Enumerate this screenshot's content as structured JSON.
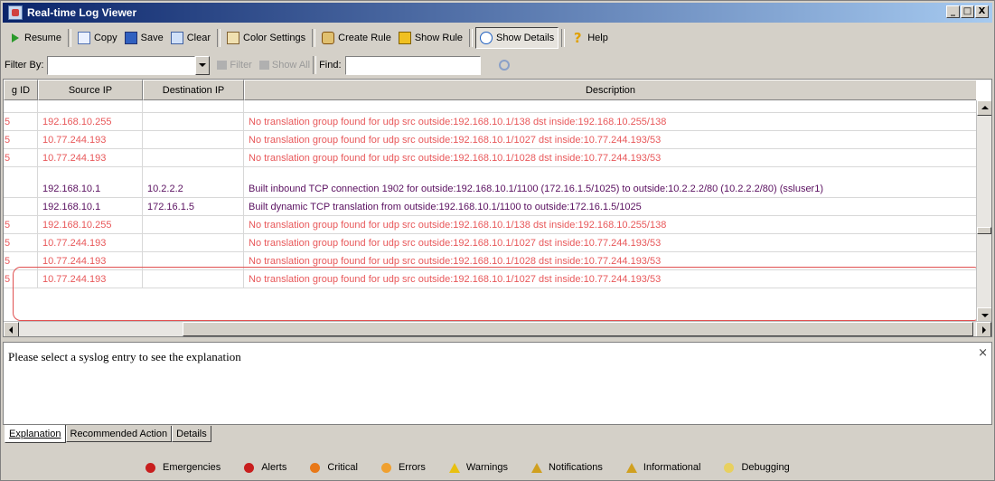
{
  "window": {
    "title": "Real-time Log Viewer",
    "buttons": [
      "_",
      "□",
      "X"
    ]
  },
  "toolbar": {
    "resume": "Resume",
    "copy": "Copy",
    "save": "Save",
    "clear": "Clear",
    "color_settings": "Color Settings",
    "create_rule": "Create Rule",
    "show_rule": "Show Rule",
    "show_details": "Show Details",
    "help": "Help"
  },
  "filterbar": {
    "filter_by_label": "Filter By:",
    "filter_by_value": "",
    "filter_btn": "Filter",
    "show_all_btn": "Show All",
    "find_label": "Find:",
    "find_value": ""
  },
  "table": {
    "headers": [
      "g ID",
      "Source IP",
      "Destination IP",
      "Description"
    ],
    "rows": [
      {
        "id": "5",
        "src": "192.168.10.255",
        "dst": "",
        "desc": "No translation group found for udp src outside:192.168.10.1/138 dst inside:192.168.10.255/138",
        "style": "red"
      },
      {
        "id": "5",
        "src": "10.77.244.193",
        "dst": "",
        "desc": "No translation group found for udp src outside:192.168.10.1/1027 dst inside:10.77.244.193/53",
        "style": "red"
      },
      {
        "id": "5",
        "src": "10.77.244.193",
        "dst": "",
        "desc": "No translation group found for udp src outside:192.168.10.1/1028 dst inside:10.77.244.193/53",
        "style": "red"
      },
      {
        "id": "",
        "src": "",
        "dst": "",
        "desc": "",
        "style": "gap"
      },
      {
        "id": "",
        "src": "192.168.10.1",
        "dst": "10.2.2.2",
        "desc": "Built inbound TCP connection 1902 for outside:192.168.10.1/1100 (172.16.1.5/1025) to outside:10.2.2.2/80 (10.2.2.2/80) (ssluser1)",
        "style": "purple"
      },
      {
        "id": "",
        "src": "192.168.10.1",
        "dst": "172.16.1.5",
        "desc": "Built dynamic TCP translation from outside:192.168.10.1/1100 to outside:172.16.1.5/1025",
        "style": "purple"
      },
      {
        "id": "5",
        "src": "192.168.10.255",
        "dst": "",
        "desc": "No translation group found for udp src outside:192.168.10.1/138 dst inside:192.168.10.255/138",
        "style": "red"
      },
      {
        "id": "5",
        "src": "10.77.244.193",
        "dst": "",
        "desc": "No translation group found for udp src outside:192.168.10.1/1027 dst inside:10.77.244.193/53",
        "style": "red"
      },
      {
        "id": "5",
        "src": "10.77.244.193",
        "dst": "",
        "desc": "No translation group found for udp src outside:192.168.10.1/1028 dst inside:10.77.244.193/53",
        "style": "red"
      },
      {
        "id": "5",
        "src": "10.77.244.193",
        "dst": "",
        "desc": "No translation group found for udp src outside:192.168.10.1/1027 dst inside:10.77.244.193/53",
        "style": "red"
      }
    ]
  },
  "explanation": {
    "message": "Please select a syslog entry to see the explanation",
    "close": "×"
  },
  "tabs": [
    "Explanation",
    "Recommended Action",
    "Details"
  ],
  "legend": [
    {
      "label": "Emergencies",
      "color": "#c81e1e",
      "shape": "dot"
    },
    {
      "label": "Alerts",
      "color": "#c81e1e",
      "shape": "dot"
    },
    {
      "label": "Critical",
      "color": "#e87818",
      "shape": "dot"
    },
    {
      "label": "Errors",
      "color": "#f0a030",
      "shape": "dot"
    },
    {
      "label": "Warnings",
      "color": "#e8c010",
      "shape": "triangle"
    },
    {
      "label": "Notifications",
      "color": "#d0a020",
      "shape": "triangle"
    },
    {
      "label": "Informational",
      "color": "#d0a020",
      "shape": "info"
    },
    {
      "label": "Debugging",
      "color": "#e8d060",
      "shape": "dot"
    }
  ]
}
